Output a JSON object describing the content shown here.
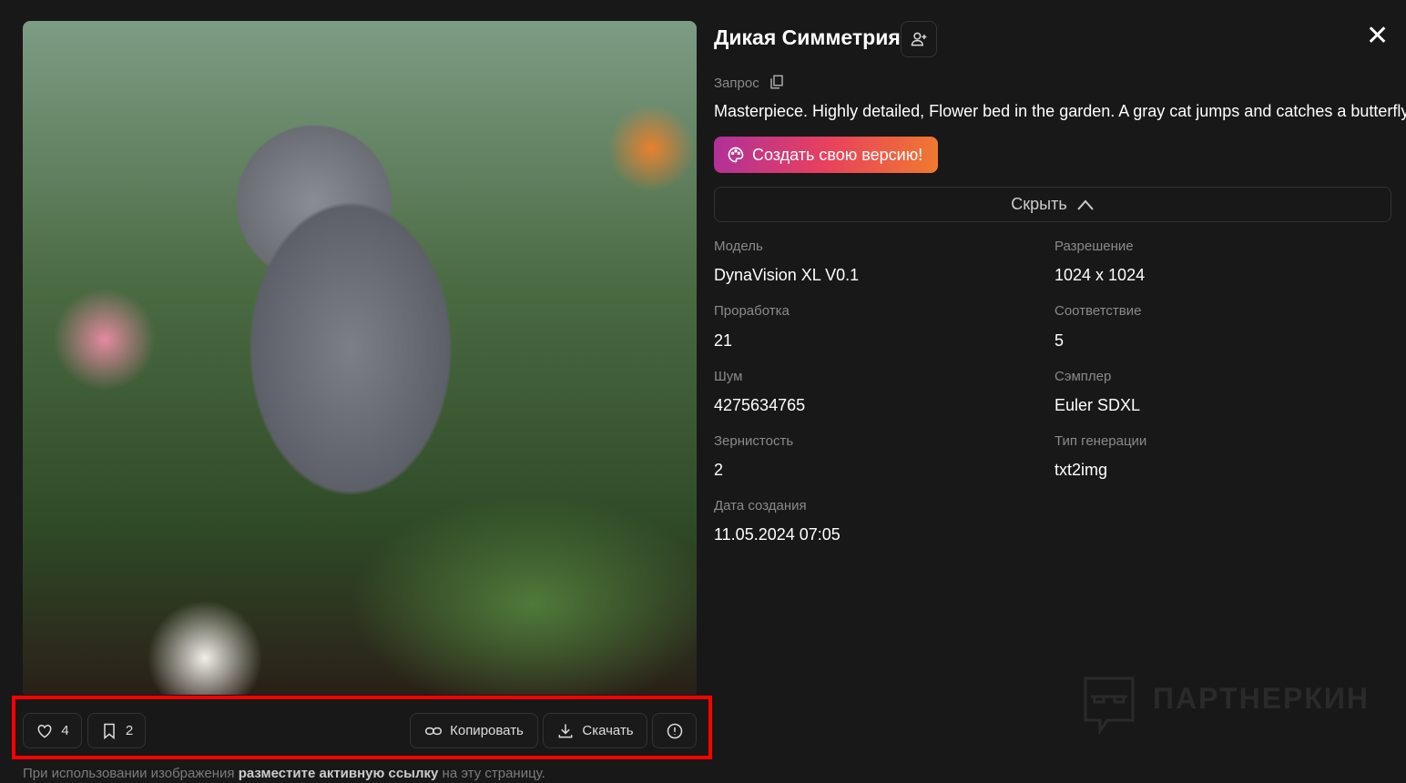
{
  "image": {
    "alt": "gray cat in flower garden with butterflies"
  },
  "actions": {
    "likes": "4",
    "bookmarks": "2",
    "copy_label": "Копировать",
    "download_label": "Скачать"
  },
  "footer_note": {
    "before": "При использовании изображения ",
    "link": "разместите активную ссылку",
    "after": " на эту страницу."
  },
  "author": {
    "name": "Дикая Симметрия"
  },
  "prompt": {
    "label": "Запрос",
    "text": "Masterpiece. Highly detailed, Flower bed in the garden. A gray cat jumps and catches a butterfly."
  },
  "create_label": "Создать свою версию!",
  "hide_label": "Скрыть",
  "params": [
    {
      "label": "Модель",
      "value": "DynaVision XL V0.1"
    },
    {
      "label": "Разрешение",
      "value": "1024 x 1024"
    },
    {
      "label": "Проработка",
      "value": "21"
    },
    {
      "label": "Соответствие",
      "value": "5"
    },
    {
      "label": "Шум",
      "value": "4275634765"
    },
    {
      "label": "Сэмплер",
      "value": "Euler SDXL"
    },
    {
      "label": "Зернистость",
      "value": "2"
    },
    {
      "label": "Тип генерации",
      "value": "txt2img"
    },
    {
      "label": "Дата создания",
      "value": "11.05.2024 07:05"
    }
  ],
  "watermark": "ПАРТНЕРКИН",
  "colors": {
    "background": "#181818",
    "highlight": "#ff0000",
    "gradient_start": "#b0309a",
    "gradient_end": "#f07a2e"
  }
}
